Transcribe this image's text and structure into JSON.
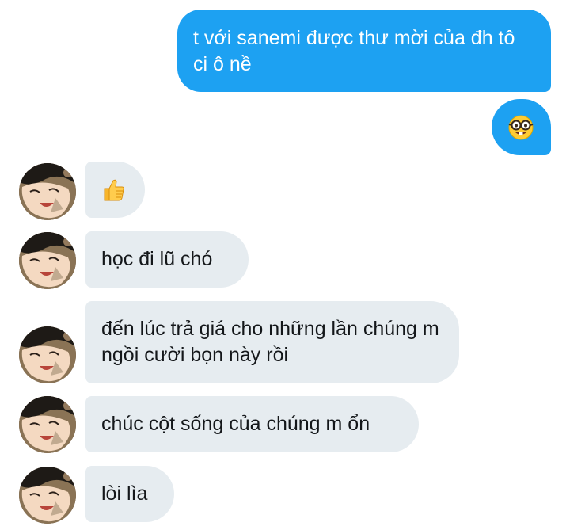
{
  "conversation": {
    "messages": [
      {
        "direction": "outgoing",
        "text": "t với sanemi được thư mời của đh tô ci ô nề"
      },
      {
        "direction": "outgoing",
        "emoji": "nerd-face"
      },
      {
        "direction": "incoming",
        "emoji": "thumbs-up"
      },
      {
        "direction": "incoming",
        "text": "học đi lũ chó"
      },
      {
        "direction": "incoming",
        "text": "đến lúc trả giá cho những lần chúng m ngồi cười bọn này rồi"
      },
      {
        "direction": "incoming",
        "text": "chúc cột sống của chúng m ổn"
      },
      {
        "direction": "incoming",
        "text": "lòi lìa"
      }
    ]
  },
  "colors": {
    "outgoing_bubble": "#1da1f2",
    "incoming_bubble": "#e6ecf0"
  }
}
